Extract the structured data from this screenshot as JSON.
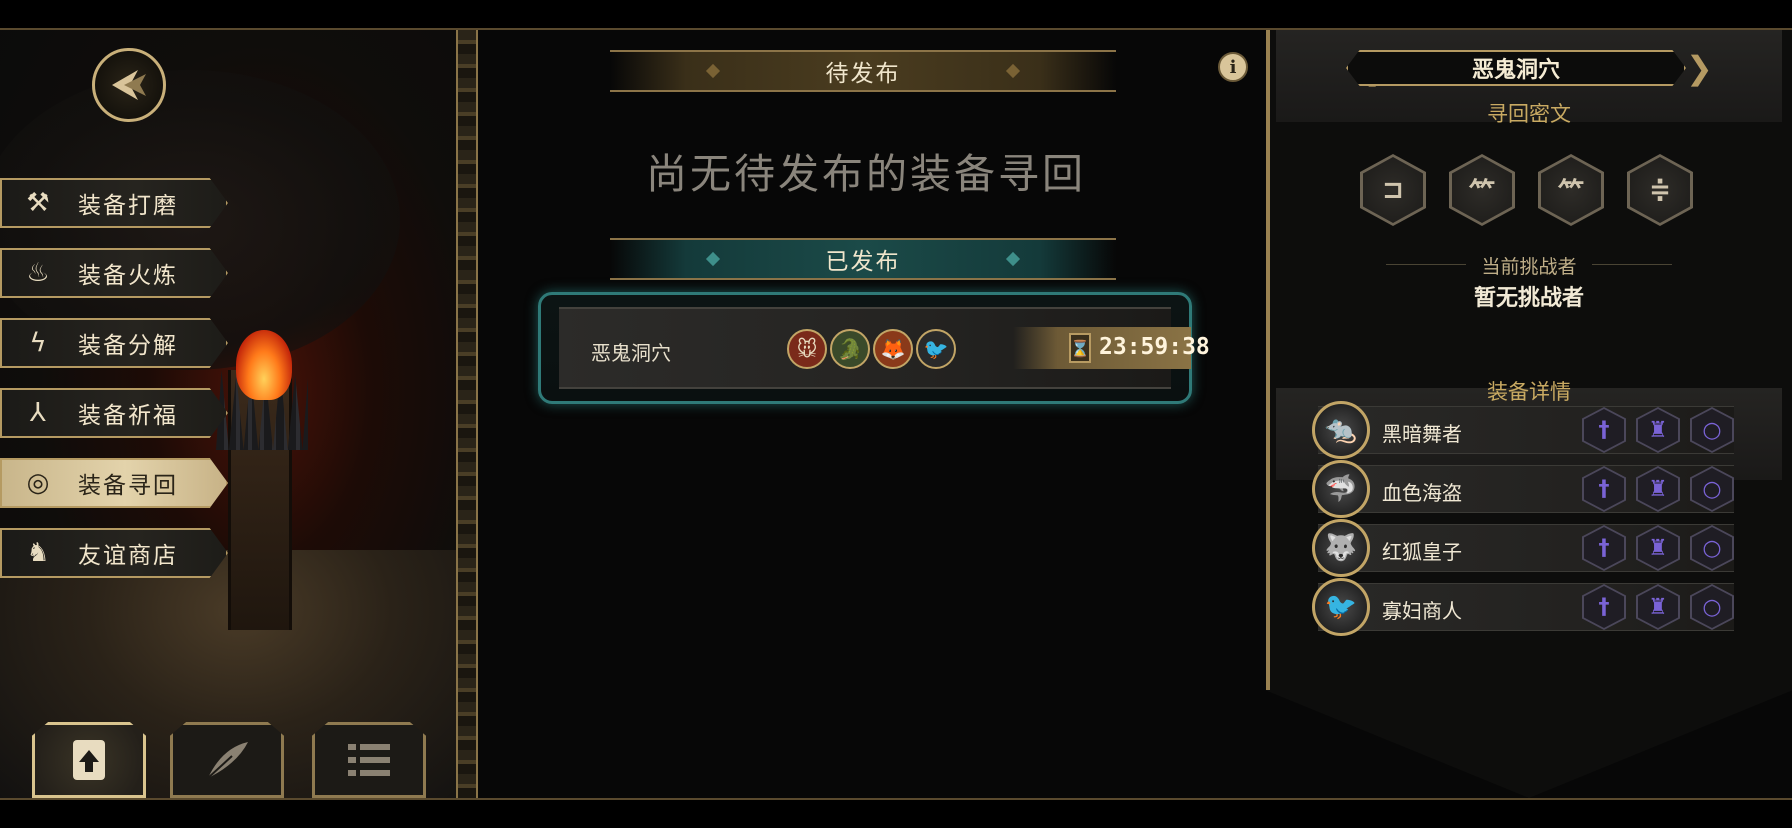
{
  "left_menu": {
    "items": [
      {
        "label": "装备打磨",
        "icon": "hammer-icon",
        "glyph": "⚒"
      },
      {
        "label": "装备火炼",
        "icon": "flame-icon",
        "glyph": "♨"
      },
      {
        "label": "装备分解",
        "icon": "lightning-icon",
        "glyph": "ϟ"
      },
      {
        "label": "装备祈福",
        "icon": "praying-hands-icon",
        "glyph": "⅄"
      },
      {
        "label": "装备寻回",
        "icon": "target-icon",
        "glyph": "◎"
      },
      {
        "label": "友谊商店",
        "icon": "fox-icon",
        "glyph": "♞"
      }
    ],
    "active_index": 4
  },
  "bottom_tabs": [
    {
      "icon": "upload-file-icon",
      "active": true
    },
    {
      "icon": "feather-icon",
      "active": false
    },
    {
      "icon": "list-icon",
      "active": false
    }
  ],
  "center": {
    "pending_banner": "待发布",
    "empty_message": "尚无待发布的装备寻回",
    "published_banner": "已发布",
    "quest": {
      "name": "恶鬼洞穴",
      "avatars": [
        {
          "icon": "mouse-hero-icon",
          "glyph": "🐭",
          "color": "#7a2a1a"
        },
        {
          "icon": "crocodile-hero-icon",
          "glyph": "🐊",
          "color": "#3a4a2a"
        },
        {
          "icon": "fox-hero-icon",
          "glyph": "🦊",
          "color": "#8a3a1a"
        },
        {
          "icon": "magpie-hero-icon",
          "glyph": "🐦",
          "color": "#2a2a2a"
        }
      ],
      "timer": "23:59:38"
    }
  },
  "info_icon": "i",
  "right_panel": {
    "title": "恶鬼洞穴",
    "secret_label": "寻回密文",
    "secret_glyphs": [
      "⊐",
      "⺮",
      "⺮",
      "≑"
    ],
    "challenger_label": "当前挑战者",
    "challenger_value": "暂无挑战者",
    "equipment_label": "装备详情",
    "heroes": [
      {
        "name": "黑暗舞者",
        "portrait": "rat-portrait-icon",
        "glyph": "🐀"
      },
      {
        "name": "血色海盗",
        "portrait": "shark-portrait-icon",
        "glyph": "🦈"
      },
      {
        "name": "红狐皇子",
        "portrait": "wolf-portrait-icon",
        "glyph": "🐺"
      },
      {
        "name": "寡妇商人",
        "portrait": "magpie-portrait-icon",
        "glyph": "🐦"
      }
    ],
    "slot_glyphs": [
      "†",
      "♜",
      "○"
    ],
    "slot_icons": [
      "sword-slot-icon",
      "armor-slot-icon",
      "ring-slot-icon"
    ]
  }
}
